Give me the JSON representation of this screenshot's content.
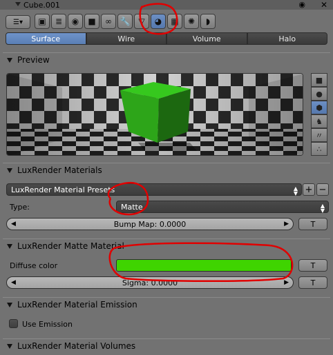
{
  "top_strip": {
    "object_name": "Cube.001"
  },
  "context_buttons": [
    {
      "icon": "render-icon",
      "glyph": "▣"
    },
    {
      "icon": "render-layers-icon",
      "glyph": "≣"
    },
    {
      "icon": "world-icon",
      "glyph": "◉"
    },
    {
      "icon": "object-icon",
      "glyph": "■"
    },
    {
      "icon": "constraints-icon",
      "glyph": "∞"
    },
    {
      "icon": "modifier-wrench-icon",
      "glyph": "🔧"
    },
    {
      "icon": "object-data-icon",
      "glyph": "▽"
    },
    {
      "icon": "material-icon",
      "glyph": "◕"
    },
    {
      "icon": "texture-icon",
      "glyph": "▦"
    },
    {
      "icon": "particles-icon",
      "glyph": "✺"
    },
    {
      "icon": "physics-icon",
      "glyph": "◗"
    }
  ],
  "tabs": [
    {
      "label": "Surface",
      "active": true
    },
    {
      "label": "Wire",
      "active": false
    },
    {
      "label": "Volume",
      "active": false
    },
    {
      "label": "Halo",
      "active": false
    }
  ],
  "preview": {
    "title": "Preview",
    "shapes": [
      "flat-plane",
      "sphere",
      "cube",
      "monkey",
      "hair",
      "sphere-array"
    ],
    "active_shape": "cube",
    "cube_color": "#2fae1a"
  },
  "materials": {
    "title": "LuxRender Materials",
    "presets": "LuxRender Material Presets",
    "type_label": "Type:",
    "type_value": "Matte",
    "bump_map": "Bump Map: 0.0000",
    "texture_button": "T"
  },
  "matte": {
    "title": "LuxRender Matte Material",
    "diffuse_label": "Diffuse color",
    "diffuse_color": "#3fd400",
    "sigma": "Sigma: 0.0000",
    "texture_button": "T"
  },
  "emission": {
    "title": "LuxRender Material Emission",
    "use_emission_label": "Use Emission",
    "use_emission": false
  },
  "volumes": {
    "title": "LuxRender Material Volumes"
  },
  "annotation_color": "#e00000"
}
